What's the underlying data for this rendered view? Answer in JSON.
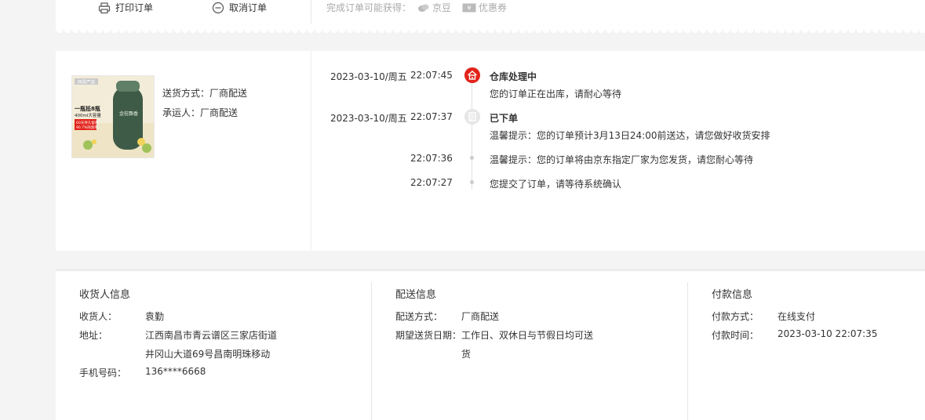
{
  "top_actions": {
    "print_label": "打印订单",
    "cancel_label": "取消订单",
    "gain_label": "完成订单可能获得：",
    "gain_jd_bean": "京豆",
    "gain_coupon": "优惠券"
  },
  "product": {
    "image_text_brand": "网易严选",
    "image_text_line1": "一瓶抵8瓶",
    "image_text_line2": "400ml大容量",
    "image_text_line3": "60天持久留香",
    "image_text_line4": "90.7%除臭率",
    "image_text_vertical": "金桂飘香"
  },
  "delivery": {
    "method_label": "送货方式：",
    "method_value": "厂商配送",
    "carrier_label": "承运人：",
    "carrier_value": "厂商配送"
  },
  "timeline": [
    {
      "date": "2023-03-10/周五",
      "time": "22:07:45",
      "title": "仓库处理中",
      "desc": "您的订单正在出库，请耐心等待",
      "status": "active"
    },
    {
      "date": "2023-03-10/周五",
      "time": "22:07:37",
      "title": "已下单",
      "desc": "温馨提示：您的订单预计3月13日24:00前送达，请您做好收货安排",
      "status": "done"
    },
    {
      "date": "",
      "time": "22:07:36",
      "title": "",
      "desc": "温馨提示：您的订单将由京东指定厂家为您发货，请您耐心等待",
      "status": "dot"
    },
    {
      "date": "",
      "time": "22:07:27",
      "title": "",
      "desc": "您提交了订单，请等待系统确认",
      "status": "dot"
    }
  ],
  "receiver": {
    "title": "收货人信息",
    "name_label": "收货人：",
    "name_value": "袁勤",
    "address_label": "地址：",
    "address_line1": "江西南昌市青云谱区三家店街道",
    "address_line2": "井冈山大道69号昌南明珠移动",
    "phone_label": "手机号码：",
    "phone_value": "136****6668"
  },
  "shipping": {
    "title": "配送信息",
    "method_label": "配送方式：",
    "method_value": "厂商配送",
    "expect_label": "期望送货日期：",
    "expect_line1": "工作日、双休日与节假日均可送",
    "expect_line2": "货"
  },
  "payment": {
    "title": "付款信息",
    "method_label": "付款方式：",
    "method_value": "在线支付",
    "time_label": "付款时间：",
    "time_value": "2023-03-10 22:07:35"
  },
  "colors": {
    "accent_red": "#e2231a",
    "divider": "#eeeeee",
    "bg": "#f4f4f4"
  }
}
